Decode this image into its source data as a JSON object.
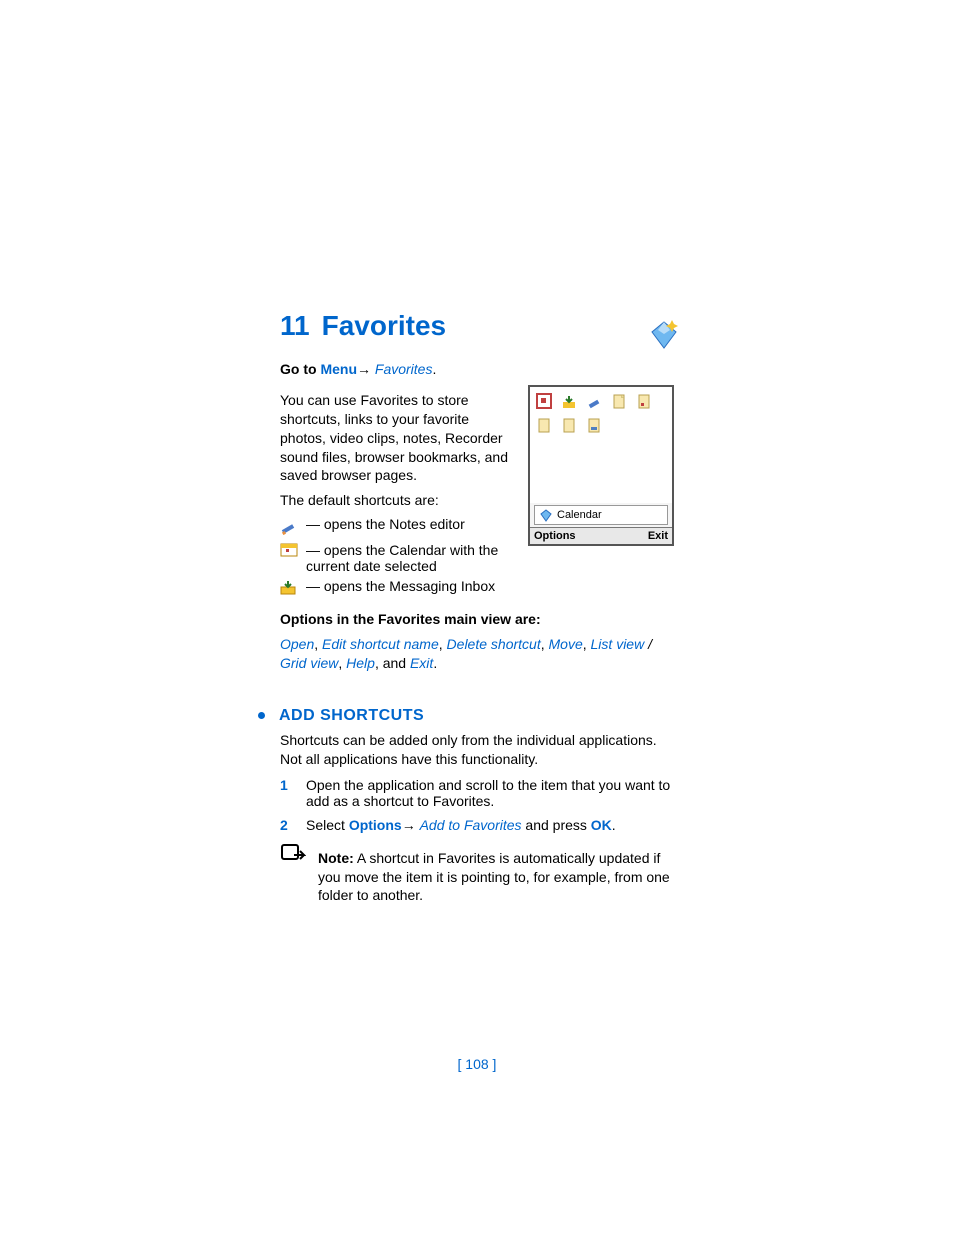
{
  "chapter": {
    "number": "11",
    "title": "Favorites"
  },
  "goto": {
    "prefix": "Go to ",
    "menu": "Menu",
    "arrow": "→ ",
    "dest": "Favorites",
    "suffix": "."
  },
  "intro": "You can use Favorites to store shortcuts, links to your favorite photos, video clips, notes, Recorder sound files, browser bookmarks, and saved browser pages.",
  "defaults_label": "The default shortcuts are:",
  "defaults": {
    "notes": "— opens the Notes editor",
    "calendar": "— opens the Calendar with the current date selected",
    "inbox": "— opens the Messaging Inbox"
  },
  "options_heading": "Options in the Favorites main view are:",
  "options": {
    "open": "Open",
    "c1": ", ",
    "editname": "Edit shortcut name",
    "c2": ", ",
    "delete": "Delete shortcut",
    "c3": ", ",
    "move": "Move",
    "c4": ", ",
    "listview": "List view",
    "slash": " / ",
    "gridview": "Grid view",
    "c5": ", ",
    "help": "Help",
    "and": ", and ",
    "exit": "Exit",
    "period": "."
  },
  "section2": {
    "title": "ADD SHORTCUTS"
  },
  "shortcuts_intro": "Shortcuts can be added only from the individual applications. Not all applications have this functionality.",
  "steps": {
    "n1": "1",
    "t1": "Open the application and scroll to the item that you want to add as a shortcut to Favorites.",
    "n2": "2",
    "t2a": "Select ",
    "t2_options": "Options",
    "t2_arrow": "→ ",
    "t2_addfav": "Add to Favorites",
    "t2b": " and press ",
    "t2_ok": "OK",
    "t2c": "."
  },
  "note": {
    "label": "Note:",
    "text": " A shortcut in Favorites is automatically updated if you move the item it is pointing to, for example, from one folder to another."
  },
  "screenshot": {
    "selected": "Calendar",
    "left_softkey": "Options",
    "right_softkey": "Exit"
  },
  "footer": "[ 108 ]"
}
